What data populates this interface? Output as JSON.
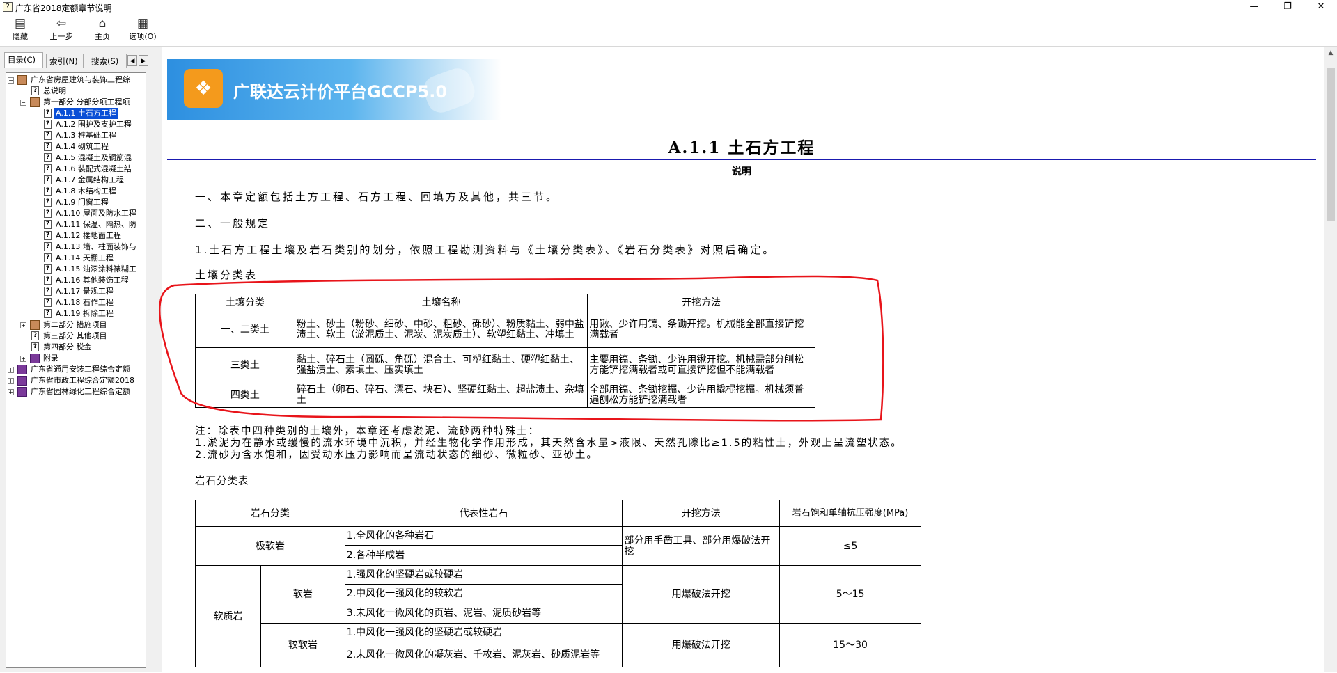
{
  "window": {
    "title": "广东省2018定额章节说明",
    "min": "—",
    "max": "❐",
    "close": "✕"
  },
  "toolbar": {
    "hide": "隐藏",
    "back": "上一步",
    "home": "主页",
    "options": "选项(O)"
  },
  "tabs": {
    "toc": "目录(C)",
    "index": "索引(N)",
    "search": "搜索(S)"
  },
  "tree": [
    {
      "label": "广东省房屋建筑与装饰工程综",
      "kind": "book-open",
      "exp": "−"
    },
    {
      "label": "总说明",
      "kind": "help"
    },
    {
      "label": "第一部分  分部分项工程项",
      "kind": "book-open",
      "exp": "−"
    },
    {
      "label": "A.1.1 土石方工程",
      "kind": "help",
      "selected": true
    },
    {
      "label": "A.1.2 围护及支护工程",
      "kind": "help"
    },
    {
      "label": "A.1.3 桩基础工程",
      "kind": "help"
    },
    {
      "label": "A.1.4 砌筑工程",
      "kind": "help"
    },
    {
      "label": "A.1.5 混凝土及钢筋混",
      "kind": "help"
    },
    {
      "label": "A.1.6 装配式混凝土结",
      "kind": "help"
    },
    {
      "label": "A.1.7 金属结构工程",
      "kind": "help"
    },
    {
      "label": "A.1.8 木结构工程",
      "kind": "help"
    },
    {
      "label": "A.1.9 门窗工程",
      "kind": "help"
    },
    {
      "label": "A.1.10  屋面及防水工程",
      "kind": "help"
    },
    {
      "label": "A.1.11  保温、隔热、防",
      "kind": "help"
    },
    {
      "label": "A.1.12  楼地面工程",
      "kind": "help"
    },
    {
      "label": "A.1.13  墙、柱面装饰与",
      "kind": "help"
    },
    {
      "label": "A.1.14  天棚工程",
      "kind": "help"
    },
    {
      "label": "A.1.15  油漆涂料裱糊工",
      "kind": "help"
    },
    {
      "label": "A.1.16  其他装饰工程",
      "kind": "help"
    },
    {
      "label": "A.1.17  景观工程",
      "kind": "help"
    },
    {
      "label": "A.1.18  石作工程",
      "kind": "help"
    },
    {
      "label": "A.1.19  拆除工程",
      "kind": "help"
    },
    {
      "label": "第二部分  措施项目",
      "kind": "book-open",
      "exp": "+"
    },
    {
      "label": "第三部分  其他项目",
      "kind": "help"
    },
    {
      "label": "第四部分  税金",
      "kind": "help"
    },
    {
      "label": "附录",
      "kind": "book-closed",
      "exp": "+"
    },
    {
      "label": "广东省通用安装工程综合定额",
      "kind": "book-closed",
      "exp": "+"
    },
    {
      "label": "广东省市政工程综合定额2018",
      "kind": "book-closed",
      "exp": "+"
    },
    {
      "label": "广东省园林绿化工程综合定额",
      "kind": "book-closed",
      "exp": "+"
    }
  ],
  "banner": {
    "text": "广联达云计价平台GCCP5.0",
    "logo": "❖"
  },
  "doc": {
    "title": "A.1.1  土石方工程",
    "subtitle": "说明",
    "p1": "一、本章定额包括土方工程、石方工程、回填方及其他，共三节。",
    "p2": "二、一般规定",
    "p3": "1.土石方工程土壤及岩石类别的划分，依照工程勘测资料与《土壤分类表》、《岩石分类表》对照后确定。",
    "soil_caption": "土壤分类表",
    "note1": "注：除表中四种类别的土壤外，本章还考虑淤泥、流砂两种特殊土：",
    "note2": "1.淤泥为在静水或缓慢的流水环境中沉积，并经生物化学作用形成，其天然含水量>液限、天然孔隙比≥1.5的粘性土，外观上呈流塑状态。",
    "note3": "2.流砂为含水饱和，因受动水压力影响而呈流动状态的细砂、微粒砂、亚砂土。",
    "rock_caption": "岩石分类表"
  },
  "soil_table": {
    "headers": [
      "土壤分类",
      "土壤名称",
      "开挖方法"
    ],
    "rows": [
      {
        "cls": "一、二类土",
        "name": "粉土、砂土（粉砂、细砂、中砂、粗砂、砾砂）、粉质黏土、弱中盐渍土、软土（淤泥质土、泥炭、泥炭质土）、软塑红黏土、冲填土",
        "method": "用锹、少许用镐、条锄开挖。机械能全部直接铲挖满载者"
      },
      {
        "cls": "三类土",
        "name": "黏土、碎石土（圆砾、角砾）混合土、可塑红黏土、硬塑红黏土、强盐渍土、素填土、压实填土",
        "method": "主要用镐、条锄、少许用锹开挖。机械需部分刨松方能铲挖满载者或可直接铲挖但不能满载者"
      },
      {
        "cls": "四类土",
        "name": "碎石土（卵石、碎石、漂石、块石）、坚硬红黏土、超盐渍土、杂填土",
        "method": "全部用镐、条锄挖掘、少许用撬棍挖掘。机械须普遍刨松方能铲挖满载者"
      }
    ]
  },
  "rock_table": {
    "headers": [
      "岩石分类",
      "代表性岩石",
      "开挖方法",
      "岩石饱和单轴抗压强度(MPa)"
    ],
    "very_soft": {
      "cls": "极软岩",
      "rocks": [
        "1.全风化的各种岩石",
        "2.各种半成岩"
      ],
      "method": "部分用手凿工具、部分用爆破法开挖",
      "strength": "≤5"
    },
    "soft_group": "软质岩",
    "soft": {
      "cls": "软岩",
      "rocks": [
        "1.强风化的坚硬岩或较硬岩",
        "2.中风化一强风化的较软岩",
        "3.未风化一微风化的页岩、泥岩、泥质砂岩等"
      ],
      "method": "用爆破法开挖",
      "strength": "5～15"
    },
    "less_soft": {
      "cls": "较软岩",
      "rocks": [
        "1.中风化一强风化的坚硬岩或较硬岩",
        "2.未风化一微风化的凝灰岩、千枚岩、泥灰岩、砂质泥岩等"
      ],
      "method": "用爆破法开挖",
      "strength": "15～30"
    }
  },
  "colors": {
    "selection": "#0a4fd6",
    "rule": "#1a1ab0",
    "annotation": "#e8141a",
    "banner": "#2d8fe0"
  }
}
